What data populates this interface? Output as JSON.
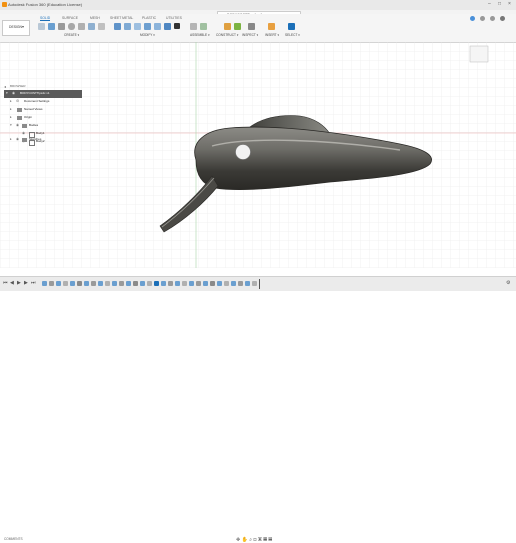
{
  "window": {
    "title": "Autodesk Fusion 360 (Education License)",
    "minimize_icon": "minimize-icon",
    "maximize_icon": "maximize-icon",
    "close_icon": "close-icon"
  },
  "document_tab": {
    "label": "BODYCOSTTips4x v1"
  },
  "workspace": {
    "label": "DESIGN"
  },
  "tabs": [
    "SOLID",
    "SURFACE",
    "MESH",
    "SHEET METAL",
    "PLASTIC",
    "UTILITIES"
  ],
  "active_tab": "SOLID",
  "tool_groups": [
    {
      "label": "CREATE ▾"
    },
    {
      "label": "MODIFY ▾"
    },
    {
      "label": "ASSEMBLE ▾"
    },
    {
      "label": "CONSTRUCT ▾"
    },
    {
      "label": "INSPECT ▾"
    },
    {
      "label": "INSERT ▾"
    },
    {
      "label": "SELECT ▾"
    }
  ],
  "browser": {
    "header": "BROWSER",
    "items": [
      {
        "label": "BODYCOSTTips4x v1"
      },
      {
        "label": "Document Settings"
      },
      {
        "label": "Named Views"
      },
      {
        "label": "Origin"
      },
      {
        "label": "Bodies"
      },
      {
        "label": "Body1"
      },
      {
        "label": "Body2"
      },
      {
        "label": "Sketches"
      }
    ]
  },
  "comments": {
    "label": "COMMENTS"
  },
  "colors": {
    "accent": "#1b6fb8",
    "body_dark": "#3a3a36",
    "body_light": "#8a8a84",
    "grid_line": "#e6e6e6",
    "origin_red": "#e06666",
    "origin_green": "#86c286"
  }
}
